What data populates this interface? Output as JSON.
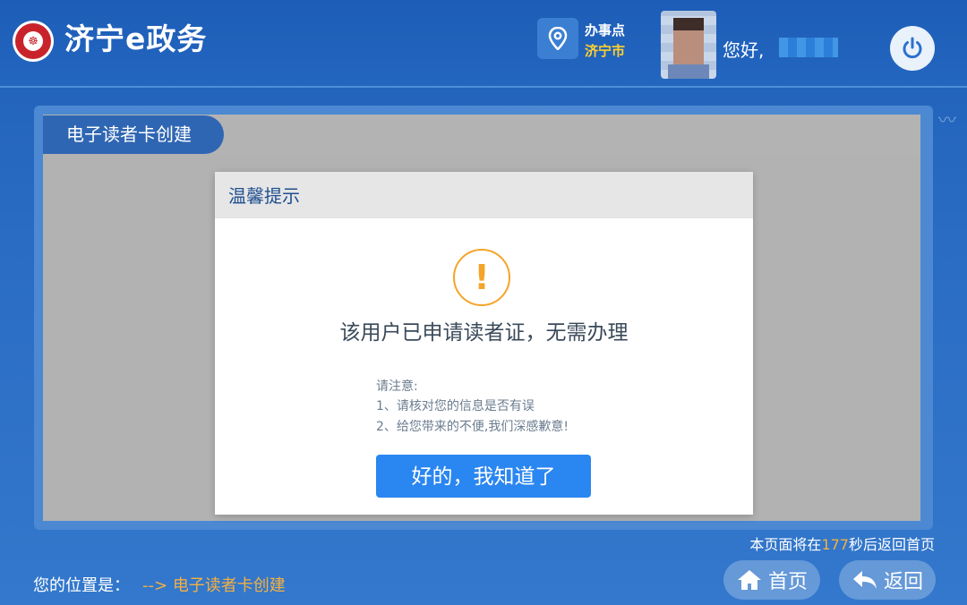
{
  "header": {
    "app_title": "济宁e政务",
    "location_label": "办事点",
    "location_value": "济宁市",
    "greeting": "您好,"
  },
  "panel": {
    "title": "电子读者卡创建"
  },
  "modal": {
    "title": "温馨提示",
    "icon": "warning-icon",
    "message": "该用户已申请读者证，无需办理",
    "notes": [
      "请注意:",
      "1、请核对您的信息是否有误",
      "2、给您带来的不便,我们深感歉意!"
    ],
    "ok_label": "好的，我知道了"
  },
  "footer": {
    "countdown_prefix": "本页面将在",
    "countdown_value": "177",
    "countdown_suffix": "秒后返回首页",
    "location_prefix": "您的位置是：",
    "location_arrow": "-->",
    "location_path": "电子读者卡创建",
    "home_label": "首页",
    "back_label": "返回"
  },
  "colors": {
    "primary": "#2366bf",
    "accent": "#f4a428",
    "button": "#2a86f0",
    "highlight": "#ffd12e"
  }
}
